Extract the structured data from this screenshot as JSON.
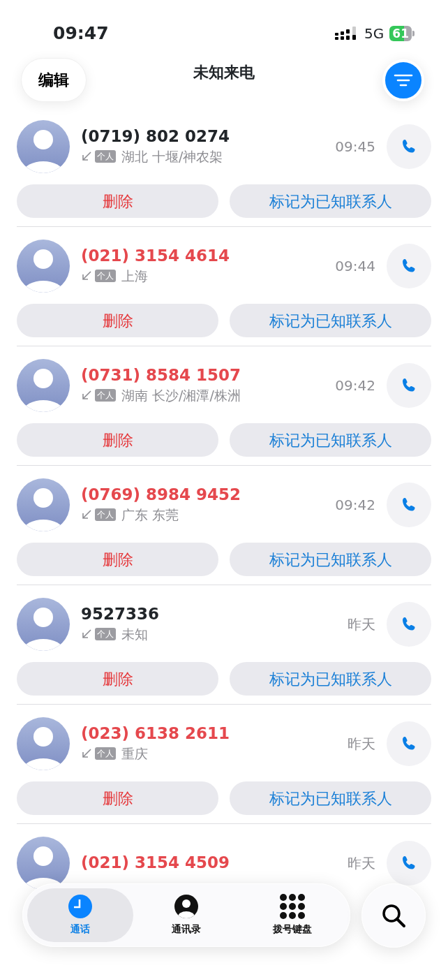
{
  "status_bar": {
    "time": "09:47",
    "network": "5G",
    "battery": "61"
  },
  "header": {
    "edit_button": "编辑",
    "title": "未知来电"
  },
  "calls": [
    {
      "number": "(0719) 802 0274",
      "missed": false,
      "tag": "个人",
      "location": "湖北 十堰/神农架",
      "time": "09:45",
      "actions": [
        "删除",
        "标记为已知联系人"
      ]
    },
    {
      "number": "(021) 3154 4614",
      "missed": true,
      "tag": "个人",
      "location": "上海",
      "time": "09:44",
      "actions": [
        "删除",
        "标记为已知联系人"
      ]
    },
    {
      "number": "(0731) 8584 1507",
      "missed": true,
      "tag": "个人",
      "location": "湖南 长沙/湘潭/株洲",
      "time": "09:42",
      "actions": [
        "删除",
        "标记为已知联系人"
      ]
    },
    {
      "number": "(0769) 8984 9452",
      "missed": true,
      "tag": "个人",
      "location": "广东 东莞",
      "time": "09:42",
      "actions": [
        "删除",
        "标记为已知联系人"
      ]
    },
    {
      "number": "9527336",
      "missed": false,
      "tag": "个人",
      "location": "未知",
      "time": "昨天",
      "actions": [
        "删除",
        "标记为已知联系人"
      ]
    },
    {
      "number": "(023) 6138 2611",
      "missed": true,
      "tag": "个人",
      "location": "重庆",
      "time": "昨天",
      "actions": [
        "删除",
        "标记为已知联系人"
      ]
    },
    {
      "number": "(021) 3154 4509",
      "missed": true,
      "time": "昨天"
    }
  ],
  "tab_bar": [
    {
      "label": "通话",
      "kind": "clock",
      "selected": true
    },
    {
      "label": "通讯录",
      "kind": "contact",
      "selected": false
    },
    {
      "label": "拨号键盘",
      "kind": "keypad",
      "selected": false
    }
  ]
}
